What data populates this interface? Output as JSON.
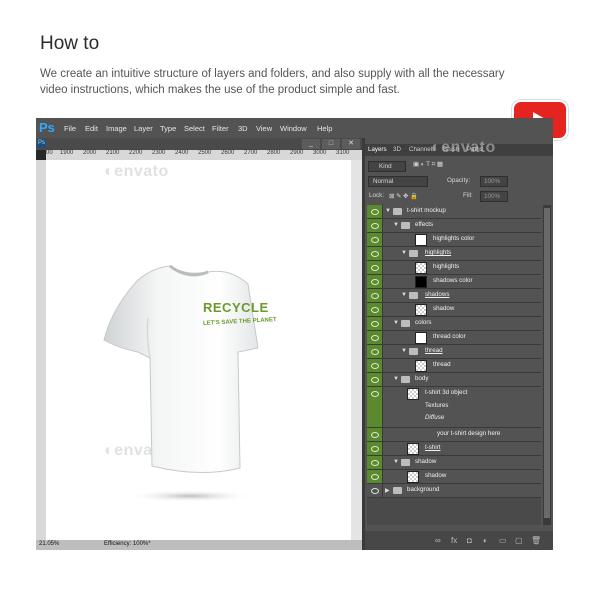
{
  "heading": {
    "title": "How to",
    "description": "We create an intuitive structure of layers and folders, and also supply with all the necessary video instructions, which makes the use of the product simple and fast."
  },
  "app": {
    "logo": "Ps",
    "menu": [
      "File",
      "Edit",
      "Image",
      "Layer",
      "Type",
      "Select",
      "Filter",
      "3D",
      "View",
      "Window",
      "Help"
    ],
    "doc_badge": "Ps",
    "window_buttons": [
      "_",
      "□",
      "✕"
    ],
    "ruler_numbers": [
      "00",
      "1900",
      "2000",
      "2100",
      "2200",
      "2300",
      "2400",
      "2500",
      "2600",
      "2700",
      "2800",
      "2900",
      "3000",
      "3100"
    ],
    "status": {
      "zoom": "21.05%",
      "efficiency": "Efficiency: 100%*"
    },
    "watermark": "envato"
  },
  "tshirt": {
    "print_main": "RECYCLE",
    "print_sub": "LET'S SAVE THE PLANET",
    "print_color": "#6a9a2c"
  },
  "panel": {
    "tabs": [
      "Layers",
      "3D",
      "Channels",
      "Brush",
      "Paths"
    ],
    "kind_label": "Kind",
    "blend_mode": "Normal",
    "opacity_label": "Opacity:",
    "opacity_value": "100%",
    "lock_label": "Lock:",
    "fill_label": "Fill:",
    "fill_value": "100%",
    "layers": [
      {
        "name": "t-shirt mockup",
        "style": "plain"
      },
      {
        "name": "effects",
        "style": "plain"
      },
      {
        "name": "highlights color",
        "style": "plain"
      },
      {
        "name": "highlights",
        "style": "underline"
      },
      {
        "name": "highlights",
        "style": "plain"
      },
      {
        "name": "shadows color",
        "style": "plain"
      },
      {
        "name": "shadows",
        "style": "underline"
      },
      {
        "name": "shadow",
        "style": "plain"
      },
      {
        "name": "colors",
        "style": "plain"
      },
      {
        "name": "thread color",
        "style": "plain"
      },
      {
        "name": "thread",
        "style": "underline"
      },
      {
        "name": "thread",
        "style": "plain"
      },
      {
        "name": "body",
        "style": "plain"
      },
      {
        "name": "t-shirt 3d object",
        "style": "plain"
      },
      {
        "name": "Textures",
        "style": "plain"
      },
      {
        "name": "Diffuse",
        "style": "italic"
      },
      {
        "name": "your t-shirt design here",
        "style": "plain"
      },
      {
        "name": "t-shirt",
        "style": "underline"
      },
      {
        "name": "shadow",
        "style": "plain"
      },
      {
        "name": "shadow",
        "style": "plain"
      },
      {
        "name": "background",
        "style": "plain"
      }
    ]
  },
  "colors": {
    "accent_green": "#5b8a2e",
    "youtube_red": "#e52420",
    "ps_blue": "#31a8ff"
  }
}
